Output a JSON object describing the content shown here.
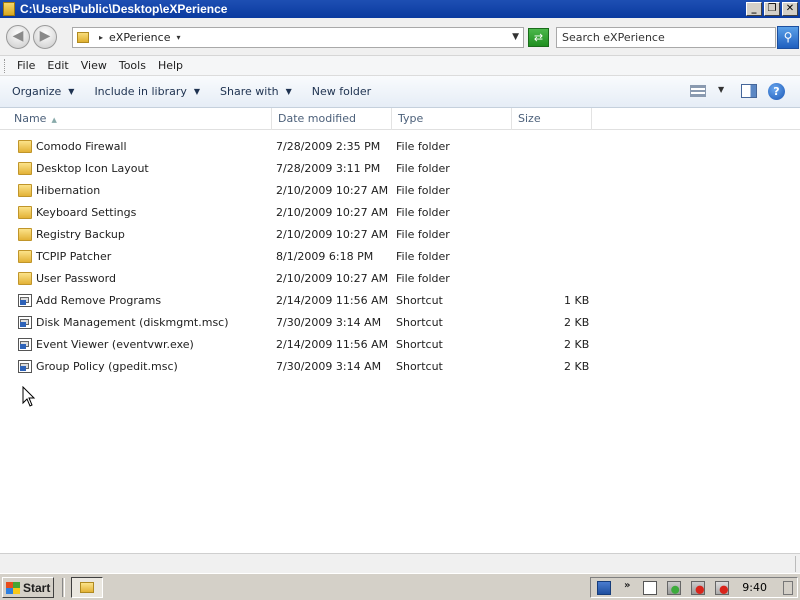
{
  "window": {
    "title": "C:\\Users\\Public\\Desktop\\eXPerience",
    "minimize": "_",
    "restore": "❐",
    "close": "✕"
  },
  "nav": {
    "back": "◀",
    "forward": "▶",
    "address_crumb": "eXPerience",
    "search_placeholder": "Search eXPerience",
    "refresh_glyph": "⇄",
    "search_glyph": "⚲"
  },
  "menu": [
    "File",
    "Edit",
    "View",
    "Tools",
    "Help"
  ],
  "commands": {
    "organize": "Organize",
    "include": "Include in library",
    "share": "Share with",
    "new_folder": "New folder",
    "help_glyph": "?"
  },
  "columns": {
    "name": "Name",
    "date": "Date modified",
    "type": "Type",
    "size": "Size"
  },
  "files": [
    {
      "name": "Comodo Firewall",
      "date": "7/28/2009 2:35 PM",
      "type": "File folder",
      "size": "",
      "icon": "folder-icon"
    },
    {
      "name": "Desktop Icon Layout",
      "date": "7/28/2009 3:11 PM",
      "type": "File folder",
      "size": "",
      "icon": "folder-icon"
    },
    {
      "name": "Hibernation",
      "date": "2/10/2009 10:27 AM",
      "type": "File folder",
      "size": "",
      "icon": "folder-icon"
    },
    {
      "name": "Keyboard Settings",
      "date": "2/10/2009 10:27 AM",
      "type": "File folder",
      "size": "",
      "icon": "folder-icon"
    },
    {
      "name": "Registry Backup",
      "date": "2/10/2009 10:27 AM",
      "type": "File folder",
      "size": "",
      "icon": "folder-icon"
    },
    {
      "name": "TCPIP Patcher",
      "date": "8/1/2009 6:18 PM",
      "type": "File folder",
      "size": "",
      "icon": "folder-icon"
    },
    {
      "name": "User Password",
      "date": "2/10/2009 10:27 AM",
      "type": "File folder",
      "size": "",
      "icon": "folder-icon"
    },
    {
      "name": "Add Remove Programs",
      "date": "2/14/2009 11:56 AM",
      "type": "Shortcut",
      "size": "1 KB",
      "icon": "shortcut-icon"
    },
    {
      "name": "Disk Management (diskmgmt.msc)",
      "date": "7/30/2009 3:14 AM",
      "type": "Shortcut",
      "size": "2 KB",
      "icon": "shortcut-icon"
    },
    {
      "name": "Event Viewer (eventvwr.exe)",
      "date": "2/14/2009 11:56 AM",
      "type": "Shortcut",
      "size": "2 KB",
      "icon": "shortcut-icon"
    },
    {
      "name": "Group Policy (gpedit.msc)",
      "date": "7/30/2009 3:14 AM",
      "type": "Shortcut",
      "size": "2 KB",
      "icon": "shortcut-icon"
    }
  ],
  "taskbar": {
    "start": "Start",
    "clock": "9:40",
    "tray_chevron": "»"
  }
}
